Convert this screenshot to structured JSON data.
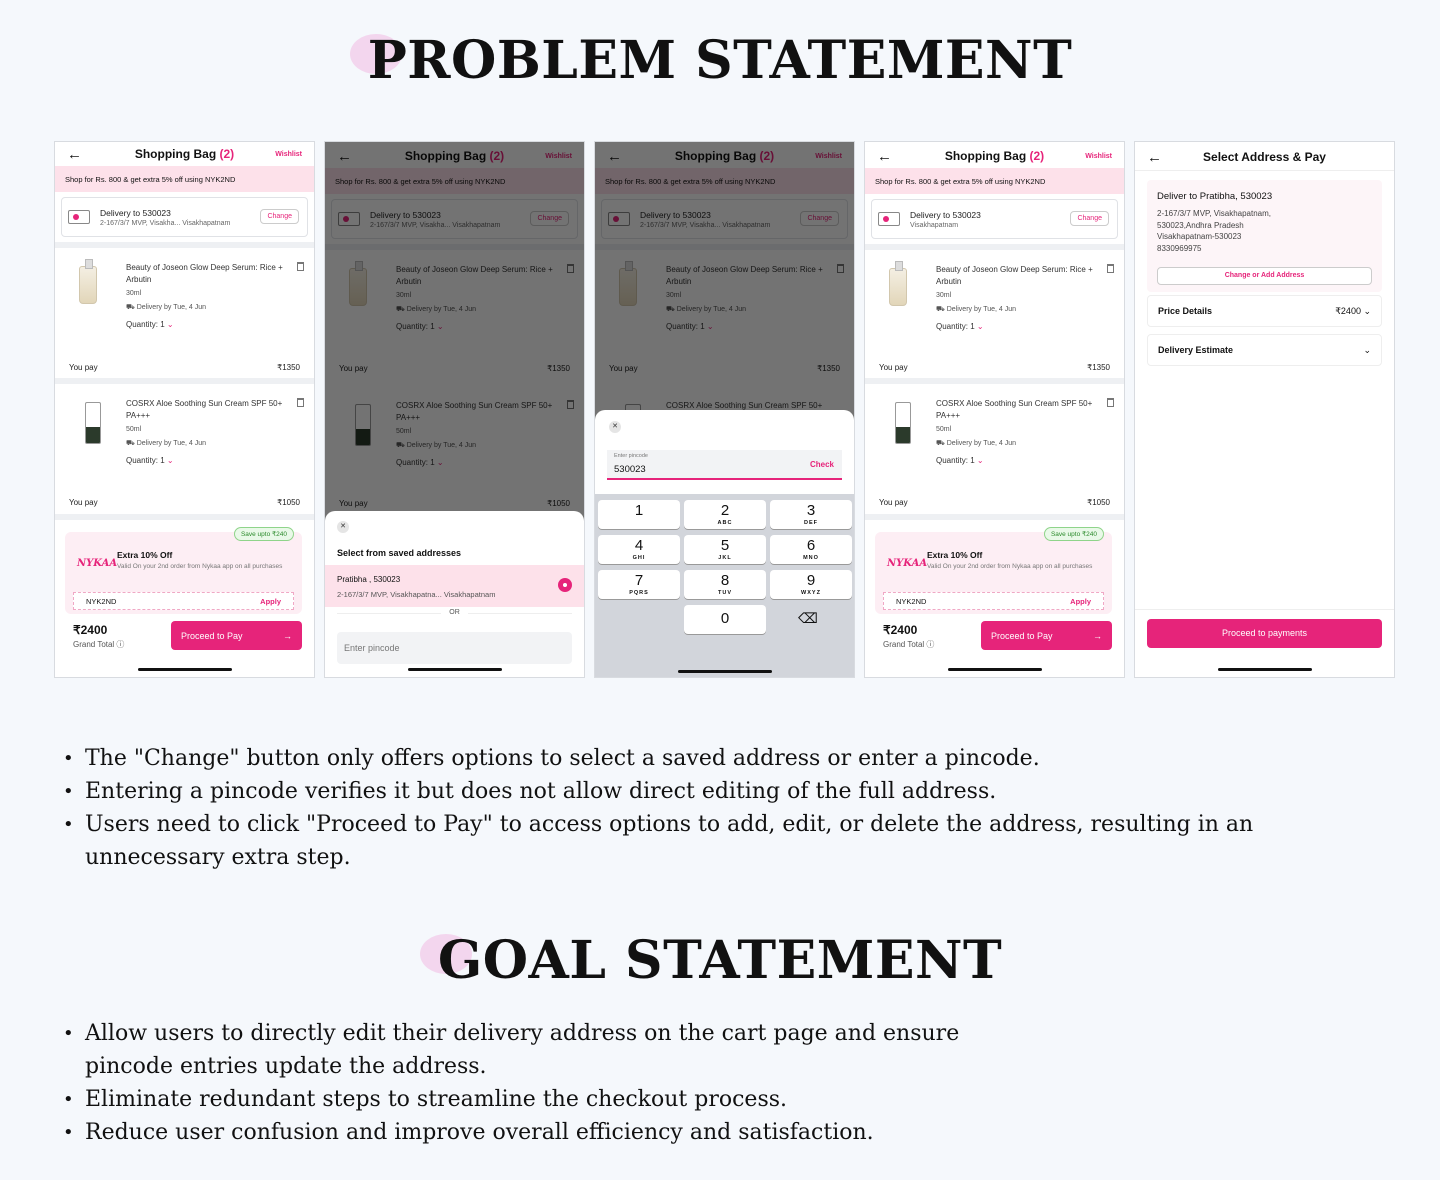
{
  "problem_heading": "PROBLEM STATEMENT",
  "goal_heading": "GOAL STATEMENT",
  "cart": {
    "title": "Shopping Bag",
    "count": "(2)",
    "wishlist": "Wishlist",
    "promo": "Shop for Rs. 800 & get extra 5% off using NYK2ND",
    "delivery_label": "Delivery to 530023",
    "delivery_addr": "2-167/3/7 MVP, Visakha...   Visakhapatnam",
    "delivery_addr_short": "Visakhapatnam",
    "change": "Change",
    "item1_name": "Beauty of Joseon Glow Deep Serum: Rice + Arbutin",
    "item1_size": "30ml",
    "item1_delivery": "⛟ Delivery by Tue, 4 Jun",
    "item1_qty": "Quantity: 1",
    "item1_price": "₹1350",
    "item2_name": "COSRX Aloe Soothing Sun Cream SPF 50+ PA+++",
    "item2_size": "50ml",
    "item2_delivery": "⛟ Delivery by Tue, 4 Jun",
    "item2_qty": "Quantity: 1",
    "item2_price": "₹1050",
    "you_pay": "You pay",
    "save_badge": "Save upto ₹240",
    "brand": "NYKAA",
    "offer_title": "Extra 10% Off",
    "offer_sub": "Valid On your 2nd order from Nykaa app on all purchases",
    "coupon": "NYK2ND",
    "apply": "Apply",
    "grand_total": "₹2400",
    "grand_total_label": "Grand Total ⓘ",
    "proceed": "Proceed to Pay"
  },
  "saved_sheet": {
    "title": "Select from saved addresses",
    "name": "Pratibha , 530023",
    "address": "2-167/3/7 MVP, Visakhapatna...   Visakhapatnam",
    "or": "OR",
    "placeholder": "Enter pincode"
  },
  "pin_sheet": {
    "label": "Enter pincode",
    "value": "530023",
    "check": "Check",
    "keys": [
      {
        "d": "1",
        "l": ""
      },
      {
        "d": "2",
        "l": "ABC"
      },
      {
        "d": "3",
        "l": "DEF"
      },
      {
        "d": "4",
        "l": "GHI"
      },
      {
        "d": "5",
        "l": "JKL"
      },
      {
        "d": "6",
        "l": "MNO"
      },
      {
        "d": "7",
        "l": "PQRS"
      },
      {
        "d": "8",
        "l": "TUV"
      },
      {
        "d": "9",
        "l": "WXYZ"
      },
      {
        "d": "0",
        "l": ""
      }
    ]
  },
  "address_pay": {
    "title": "Select Address & Pay",
    "deliver_to": "Deliver to Pratibha, 530023",
    "address": "2-167/3/7 MVP, Visakhapatnam,\n530023,Andhra Pradesh\nVisakhapatnam-530023\n8330969975",
    "change_add": "Change or Add Address",
    "price_details": "Price Details",
    "price_value": "₹2400 ⌄",
    "delivery_estimate": "Delivery Estimate",
    "proceed_payments": "Proceed to payments"
  },
  "problem_points": [
    "The \"Change\" button only offers options to select a saved address or enter a pincode.",
    "Entering a pincode verifies it but does not allow direct editing of the full address.",
    "Users need to click \"Proceed to Pay\" to access options to add, edit, or delete the address, resulting in an unnecessary extra step."
  ],
  "goal_points": [
    "Allow users to directly edit their delivery address on the cart page and ensure pincode entries update the address.",
    "Eliminate redundant steps to streamline the checkout process.",
    "Reduce user confusion and improve overall efficiency and satisfaction."
  ]
}
